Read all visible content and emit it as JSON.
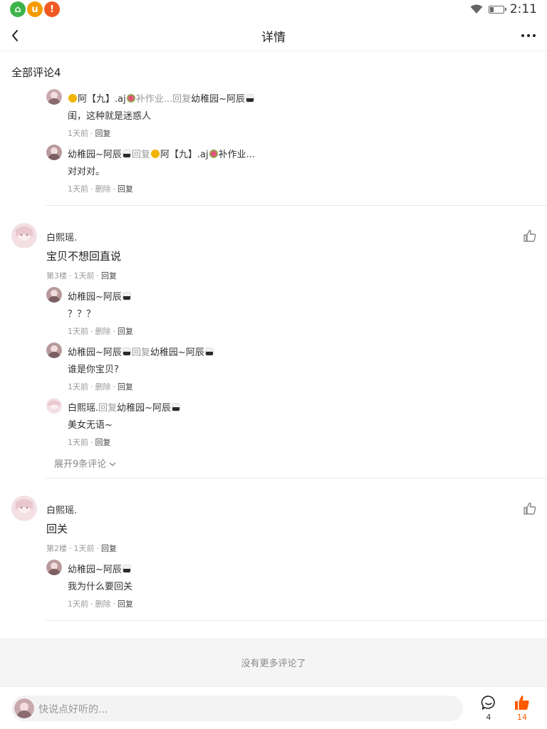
{
  "status_bar": {
    "time": "2:11",
    "app_icons": [
      "⌂",
      "u",
      "!"
    ],
    "battery_level": 0.25
  },
  "nav": {
    "title": "详情"
  },
  "section": {
    "title": "全部评论4"
  },
  "colors": {
    "accent": "#ff5a00",
    "meta_gray": "#999999",
    "divider": "#e8e8e8"
  },
  "thread_top": {
    "replies": [
      {
        "name": "阿【九】.aj",
        "gray": "补作业...回复",
        "target": "幼稚园~阿辰",
        "text": "闺，这种就是迷惑人",
        "time": "1天前",
        "delete": "",
        "reply": "回复"
      },
      {
        "name": "幼稚园~阿辰",
        "gray": "回复",
        "target": "阿【九】.aj",
        "target_suffix": "补作业...",
        "text": "对对对。",
        "time": "1天前",
        "delete": "删除",
        "reply": "回复"
      }
    ]
  },
  "comments": [
    {
      "name": "白熙瑶.",
      "text": "宝贝不想回直说",
      "floor": "第3楼",
      "time": "1天前",
      "reply": "回复",
      "replies": [
        {
          "name": "幼稚园~阿辰",
          "text": "？？？",
          "time": "1天前",
          "delete": "删除",
          "reply": "回复"
        },
        {
          "name": "幼稚园~阿辰",
          "gray": "回复",
          "target": "幼稚园~阿辰",
          "text": "谁是你宝贝?",
          "time": "1天前",
          "delete": "删除",
          "reply": "回复"
        },
        {
          "name": "白熙瑶.",
          "gray": "回复",
          "target": "幼稚园~阿辰",
          "text": "美女无语~",
          "time": "1天前",
          "reply": "回复"
        }
      ],
      "expand": "展开9条评论"
    },
    {
      "name": "白熙瑶.",
      "text": "回关",
      "floor": "第2楼",
      "time": "1天前",
      "reply": "回复",
      "replies": [
        {
          "name": "幼稚园~阿辰",
          "text": "我为什么要回关",
          "time": "1天前",
          "delete": "删除",
          "reply": "回复"
        }
      ]
    }
  ],
  "no_more": "没有更多评论了",
  "bottom_bar": {
    "placeholder": "快说点好听的...",
    "comment_count": "4",
    "like_count": "14"
  },
  "icons": {
    "back": "back-arrow-icon",
    "more": "more-dots-icon",
    "like": "thumb-up-icon",
    "comment": "comment-bubble-icon"
  }
}
